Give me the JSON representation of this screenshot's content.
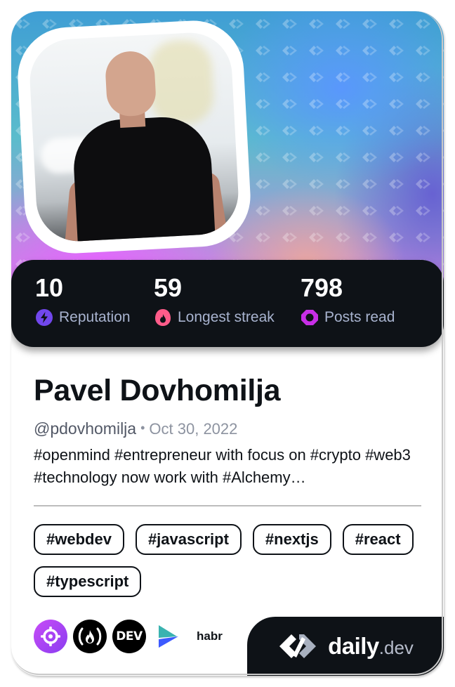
{
  "profile": {
    "name": "Pavel Dovhomilja",
    "handle": "@pdovhomilja",
    "separator": "•",
    "joined": "Oct 30, 2022",
    "bio": "#openmind #entrepreneur with focus on #crypto #web3 #technology now work with #Alchemy…"
  },
  "stats": [
    {
      "value": "10",
      "label": "Reputation",
      "icon": "reputation-bolt-icon",
      "color": "#7147ed"
    },
    {
      "value": "59",
      "label": "Longest streak",
      "icon": "streak-flame-icon",
      "color": "#ff5c8a"
    },
    {
      "value": "798",
      "label": "Posts read",
      "icon": "posts-read-ring-icon",
      "color": "#c72ee6"
    }
  ],
  "tags": [
    "#webdev",
    "#javascript",
    "#nextjs",
    "#react",
    "#typescript"
  ],
  "sources": [
    {
      "name": "crosshair-source-icon",
      "color": "#b23ef2"
    },
    {
      "name": "freecodecamp-source-icon",
      "color": "#0e1217"
    },
    {
      "name": "dev-to-source-icon",
      "color": "#0e1217",
      "label": "DEV"
    },
    {
      "name": "arrow-source-icon",
      "color": "#3d5aff"
    },
    {
      "name": "habr-source-icon",
      "label": "habr"
    }
  ],
  "brand": {
    "word": "daily",
    "tld": ".dev"
  },
  "colors": {
    "dark": "#0e1217",
    "stat_label": "#a8b3cf"
  }
}
